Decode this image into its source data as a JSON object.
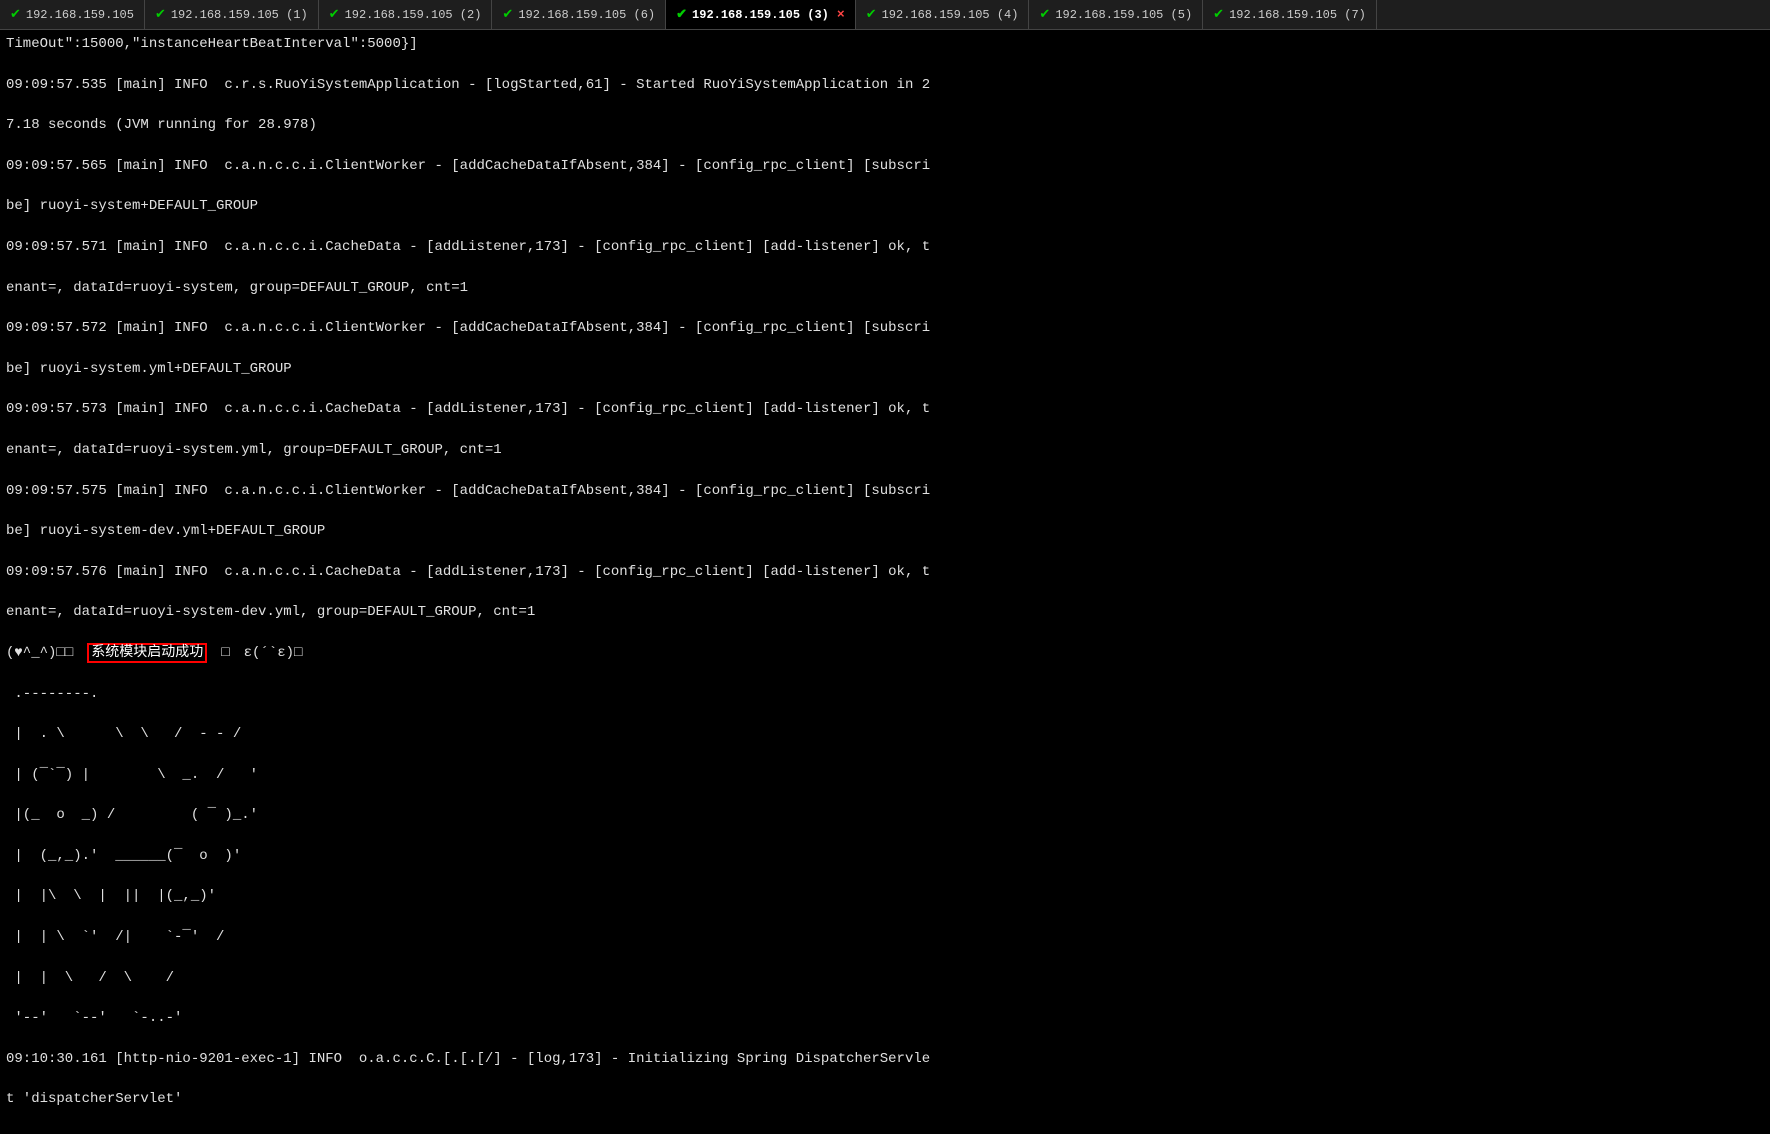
{
  "tabs": [
    {
      "label": "192.168.159.105",
      "id": "tab0",
      "active": false,
      "hasX": false
    },
    {
      "label": "192.168.159.105 (1)",
      "id": "tab1",
      "active": false,
      "hasX": false
    },
    {
      "label": "192.168.159.105 (2)",
      "id": "tab2",
      "active": false,
      "hasX": false
    },
    {
      "label": "192.168.159.105 (6)",
      "id": "tab6",
      "active": false,
      "hasX": false
    },
    {
      "label": "192.168.159.105 (3)",
      "id": "tab3",
      "active": true,
      "hasX": true
    },
    {
      "label": "192.168.159.105 (4)",
      "id": "tab4",
      "active": false,
      "hasX": false
    },
    {
      "label": "192.168.159.105 (5)",
      "id": "tab5",
      "active": false,
      "hasX": false
    },
    {
      "label": "192.168.159.105 (7)",
      "id": "tab7",
      "active": false,
      "hasX": false
    }
  ],
  "terminal": {
    "lines": [
      "TimeOut\":15000,\"instanceHeartBeatInterval\":5000}]",
      "09:09:57.535 [main] INFO  c.r.s.RuoYiSystemApplication - [logStarted,61] - Started RuoYiSystemApplication in 2",
      "7.18 seconds (JVM running for 28.978)",
      "09:09:57.565 [main] INFO  c.a.n.c.c.i.ClientWorker - [addCacheDataIfAbsent,384] - [config_rpc_client] [subscri",
      "be] ruoyi-system+DEFAULT_GROUP",
      "09:09:57.571 [main] INFO  c.a.n.c.c.i.CacheData - [addListener,173] - [config_rpc_client] [add-listener] ok, t",
      "enant=, dataId=ruoyi-system, group=DEFAULT_GROUP, cnt=1",
      "09:09:57.572 [main] INFO  c.a.n.c.c.i.ClientWorker - [addCacheDataIfAbsent,384] - [config_rpc_client] [subscri",
      "be] ruoyi-system.yml+DEFAULT_GROUP",
      "09:09:57.573 [main] INFO  c.a.n.c.c.i.CacheData - [addListener,173] - [config_rpc_client] [add-listener] ok, t",
      "enant=, dataId=ruoyi-system.yml, group=DEFAULT_GROUP, cnt=1",
      "09:09:57.575 [main] INFO  c.a.n.c.c.i.ClientWorker - [addCacheDataIfAbsent,384] - [config_rpc_client] [subscri",
      "be] ruoyi-system-dev.yml+DEFAULT_GROUP",
      "09:09:57.576 [main] INFO  c.a.n.c.c.i.CacheData - [addListener,173] - [config_rpc_client] [add-listener] ok, t",
      "enant=, dataId=ruoyi-system-dev.yml, group=DEFAULT_GROUP, cnt=1"
    ],
    "special_line": "(♥^_^)□□　系统模块启动成功　□　ε(´`ε)□",
    "highlight_text": "系统模块启动成功",
    "ascii_art": [
      " .--------.",
      " |  . \\      \\  \\   /  - - /",
      " | (¯`¯) |        \\  _.  /   '",
      " |(_  ο  _) /         ( ¯ )_.'",
      " |  (_,_).'  ______(¯  ο  )'",
      " |  |\\  \\  |  ||  |(_,_)'",
      " |  | \\  `'  /|    `-¯'  /",
      " |  |  \\   /  \\    /",
      " '--'   `--'   `-..-'"
    ],
    "footer_lines": [
      "09:10:30.161 [http-nio-9201-exec-1] INFO  o.a.c.c.C.[.[.[/] - [log,173] - Initializing Spring DispatcherServle",
      "t 'dispatcherServlet'"
    ]
  }
}
